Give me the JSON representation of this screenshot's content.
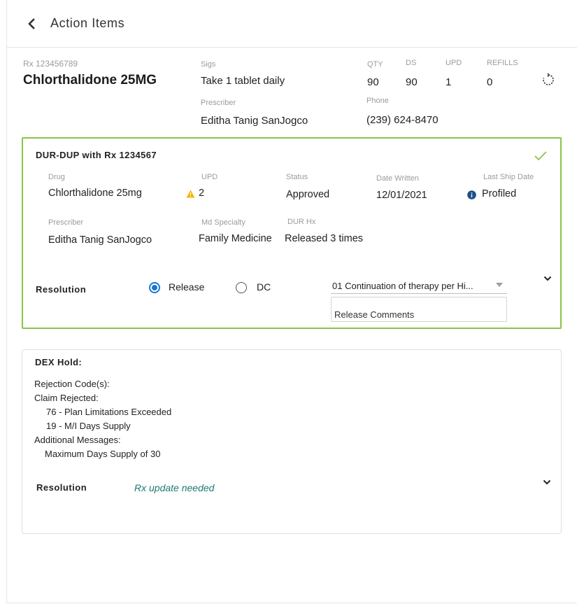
{
  "header": {
    "title": "Action Items"
  },
  "rx": {
    "number": "Rx 123456789",
    "drug_name": "Chlorthalidone 25MG",
    "sigs_label": "Sigs",
    "sigs_value": "Take 1 tablet daily",
    "prescriber_label": "Prescriber",
    "prescriber_value": "Editha Tanig SanJogco",
    "qty_label": "QTY",
    "qty_value": "90",
    "ds_label": "DS",
    "ds_value": "90",
    "upd_label": "UPD",
    "upd_value": "1",
    "refills_label": "REFILLS",
    "refills_value": "0",
    "phone_label": "Phone",
    "phone_value": "(239) 624-8470"
  },
  "dur": {
    "title": "DUR-DUP with Rx 1234567",
    "drug_label": "Drug",
    "drug_value": "Chlorthalidone 25mg",
    "upd_label": "UPD",
    "upd_value": "2",
    "status_label": "Status",
    "status_value": "Approved",
    "date_written_label": "Date Written",
    "date_written_value": "12/01/2021",
    "last_ship_label": "Last Ship Date",
    "last_ship_value": "Profiled",
    "prescriber_label": "Prescriber",
    "prescriber_value": "Editha Tanig SanJogco",
    "specialty_label": "Md Specialty",
    "specialty_value": "Family Medicine",
    "durhx_label": "DUR Hx",
    "durhx_value": "Released 3 times",
    "resolution_label": "Resolution",
    "option_release": "Release",
    "option_dc": "DC",
    "selected_option": "Release",
    "reason_value": "01 Continuation of therapy per Hi...",
    "comments_value": "Release Comments",
    "border_color": "#8bc34a"
  },
  "dex": {
    "title": "DEX Hold:",
    "rejection_codes": "Rejection Code(s):",
    "claim_rejected": "Claim Rejected:",
    "code_1": "76 - Plan Limitations Exceeded",
    "code_2": "19 - M/I Days Supply",
    "additional_messages": "Additional Messages:",
    "message_1": "Maximum Days Supply of 30",
    "resolution_label": "Resolution",
    "resolution_value": "Rx update needed"
  },
  "icons": {
    "back": "chevron-left-icon",
    "refresh": "refresh-icon",
    "check": "check-icon",
    "warning": "warning-icon",
    "info": "info-icon",
    "expand": "chevron-down-icon"
  },
  "colors": {
    "accent": "#1976d2",
    "success": "#8bc34a",
    "warning": "#f5b400",
    "link": "#1f7a72"
  }
}
